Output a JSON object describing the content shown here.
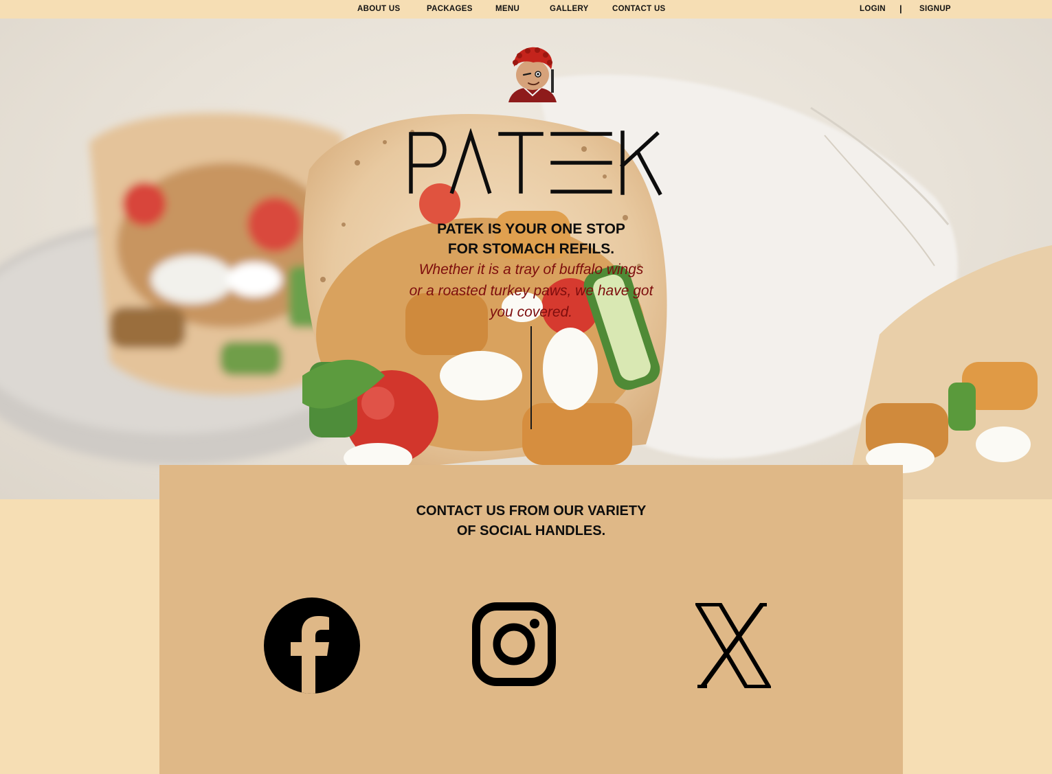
{
  "nav": {
    "items": [
      {
        "label": "ABOUT US"
      },
      {
        "label": "PACKAGES"
      },
      {
        "label": "MENU"
      },
      {
        "label": "GALLERY"
      },
      {
        "label": "CONTACT US"
      }
    ],
    "login": "LOGIN",
    "separator": "|",
    "signup": "SIGNUP"
  },
  "hero": {
    "brand": "PATEK",
    "tagline_line1": "PATEK IS YOUR ONE STOP",
    "tagline_line2": "FOR STOMACH REFILS.",
    "subtag_line1": "Whether it is a tray of buffalo wings",
    "subtag_line2": "or a roasted turkey paws, we have got",
    "subtag_line3": "you covered."
  },
  "contact": {
    "title_line1": "CONTACT US FROM OUR VARIETY",
    "title_line2": "OF SOCIAL HANDLES.",
    "socials": [
      {
        "name": "facebook",
        "icon": "facebook-icon"
      },
      {
        "name": "instagram",
        "icon": "instagram-icon"
      },
      {
        "name": "x",
        "icon": "x-icon"
      }
    ]
  },
  "colors": {
    "page_bg": "#f6deb4",
    "card_bg": "#dfb887",
    "accent_text": "#7d0d0d",
    "text": "#0d0d0d"
  }
}
